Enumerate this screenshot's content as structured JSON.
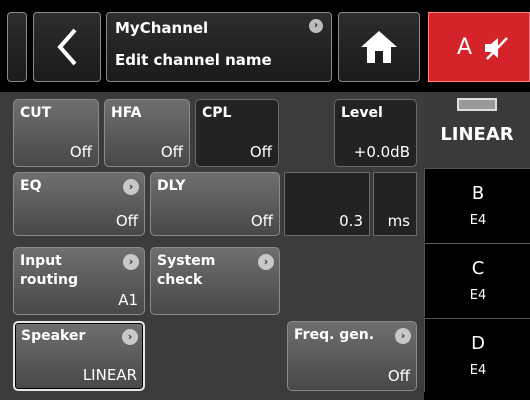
{
  "header": {
    "back_icon": "chevron-left-icon",
    "channel_name": "MyChannel",
    "page_title": "Edit channel name",
    "home_icon": "home-icon",
    "mute_label": "A",
    "mute_icon": "speaker-muted-icon",
    "accent_color": "#d4242a"
  },
  "controls": {
    "cut": {
      "label": "CUT",
      "value": "Off"
    },
    "hfa": {
      "label": "HFA",
      "value": "Off"
    },
    "cpl": {
      "label": "CPL",
      "value": "Off"
    },
    "level": {
      "label": "Level",
      "value": "+0.0dB"
    },
    "eq": {
      "label": "EQ",
      "value": "Off"
    },
    "dly": {
      "label": "DLY",
      "value": "Off",
      "amount": "0.3",
      "unit": "ms"
    },
    "input_routing": {
      "label": "Input\nrouting",
      "value": "A1"
    },
    "system_check": {
      "label": "System\ncheck"
    },
    "speaker": {
      "label": "Speaker",
      "value": "LINEAR"
    },
    "freq_gen": {
      "label": "Freq. gen.",
      "value": "Off"
    }
  },
  "sidebar": {
    "active_tab": "LINEAR",
    "channels": [
      {
        "letter": "B",
        "sub": "E4"
      },
      {
        "letter": "C",
        "sub": "E4"
      },
      {
        "letter": "D",
        "sub": "E4"
      }
    ]
  }
}
